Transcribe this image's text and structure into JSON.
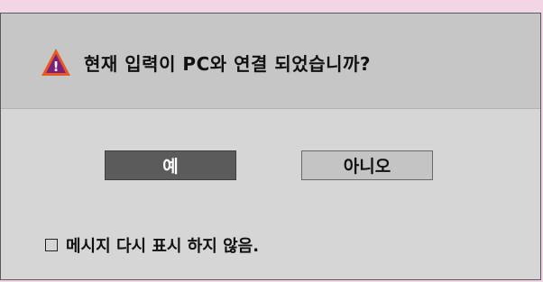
{
  "dialog": {
    "title": "현재 입력이 PC와 연결 되었습니까?",
    "warning_icon": "warning-triangle-icon",
    "warning_icon_fill": "#e8591f",
    "warning_icon_mark_bg": "#7a1f7a",
    "warning_icon_mark": "!",
    "buttons": {
      "yes_label": "예",
      "no_label": "아니오"
    },
    "dont_show_again": {
      "checked": false,
      "label": "메시지 다시 표시 하지 않음."
    }
  }
}
